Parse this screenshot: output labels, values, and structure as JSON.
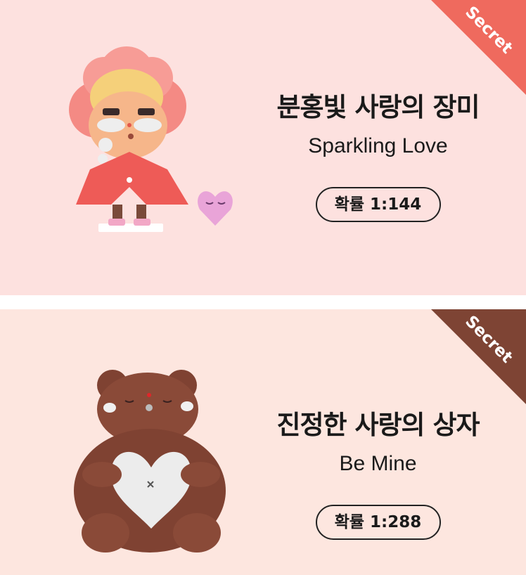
{
  "cards": [
    {
      "title_ko": "분홍빛 사랑의 장미",
      "title_en": "Sparkling Love",
      "probability": "확률 1:144",
      "badge": "Secret",
      "background": "#fde1df",
      "badge_color": "#ef6a5e",
      "figure_icon": "rose-girl-figure"
    },
    {
      "title_ko": "진정한 사랑의 상자",
      "title_en": "Be Mine",
      "probability": "확률 1:288",
      "badge": "Secret",
      "background": "#fde6df",
      "badge_color": "#7e4434",
      "figure_icon": "bear-heart-figure"
    }
  ]
}
